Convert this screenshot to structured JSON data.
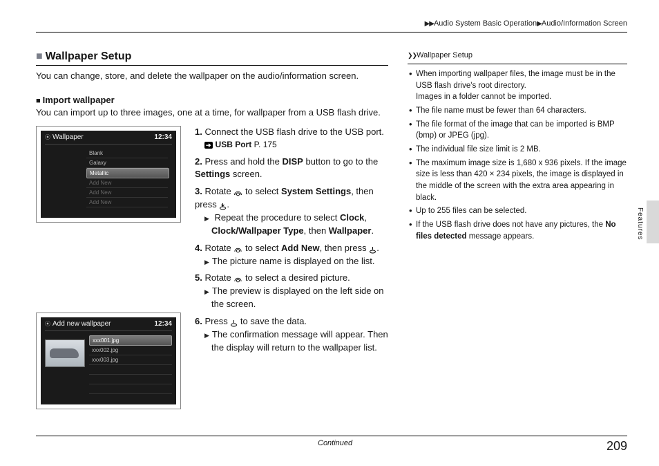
{
  "breadcrumb": {
    "section": "Audio System Basic Operation",
    "subsection": "Audio/Information Screen"
  },
  "main": {
    "title": "Wallpaper Setup",
    "intro": "You can change, store, and delete the wallpaper on the audio/information screen.",
    "sub_title": "Import wallpaper",
    "sub_intro": "You can import up to three images, one at a time, for wallpaper from a USB flash drive.",
    "fig1": {
      "title": "Wallpaper",
      "time": "12:34",
      "items": [
        "Blank",
        "Galaxy",
        "Metallic",
        "Add New",
        "Add New",
        "Add New"
      ]
    },
    "fig2": {
      "title": "Add new wallpaper",
      "time": "12:34",
      "items": [
        "xxx001.jpg",
        "xxx002.jpg",
        "xxx003.jpg"
      ]
    },
    "steps": {
      "s1_num": "1.",
      "s1": "Connect the USB flash drive to the USB port.",
      "s1_xref_label": "USB Port",
      "s1_xref_page": "P. 175",
      "s2_num": "2.",
      "s2_a": "Press and hold the ",
      "s2_b": "DISP",
      "s2_c": " button to go to the ",
      "s2_d": "Settings",
      "s2_e": " screen.",
      "s3_num": "3.",
      "s3_a": "Rotate ",
      "s3_b": " to select ",
      "s3_c": "System Settings",
      "s3_d": ", then press ",
      "s3_e": ".",
      "s3_sub_a": "Repeat the procedure to select ",
      "s3_sub_b": "Clock",
      "s3_sub_c": ", ",
      "s3_sub_d": "Clock/Wallpaper Type",
      "s3_sub_e": ", then ",
      "s3_sub_f": "Wallpaper",
      "s3_sub_g": ".",
      "s4_num": "4.",
      "s4_a": "Rotate ",
      "s4_b": " to select ",
      "s4_c": "Add New",
      "s4_d": ", then press ",
      "s4_e": ".",
      "s4_sub": "The picture name is displayed on the list.",
      "s5_num": "5.",
      "s5_a": "Rotate ",
      "s5_b": " to select a desired picture.",
      "s5_sub": "The preview is displayed on the left side on the screen.",
      "s6_num": "6.",
      "s6_a": "Press ",
      "s6_b": " to save the data.",
      "s6_sub": "The confirmation message will appear. Then the display will return to the wallpaper list."
    }
  },
  "side": {
    "title": "Wallpaper Setup",
    "n1a": "When importing wallpaper files, the image must be in the USB flash drive's root directory.",
    "n1b": "Images in a folder cannot be imported.",
    "n2": "The file name must be fewer than 64 characters.",
    "n3": "The file format of the image that can be imported is BMP (bmp) or JPEG (jpg).",
    "n4": "The individual file size limit is 2 MB.",
    "n5": "The maximum image size is 1,680 x 936 pixels. If the image size is less than 420 × 234 pixels, the image is displayed in the middle of the screen with the extra area appearing in black.",
    "n6": "Up to 255 files can be selected.",
    "n7a": "If the USB flash drive does not have any pictures, the ",
    "n7b": "No files detected",
    "n7c": " message appears."
  },
  "tab": "Features",
  "footer": {
    "continued": "Continued",
    "page": "209"
  }
}
